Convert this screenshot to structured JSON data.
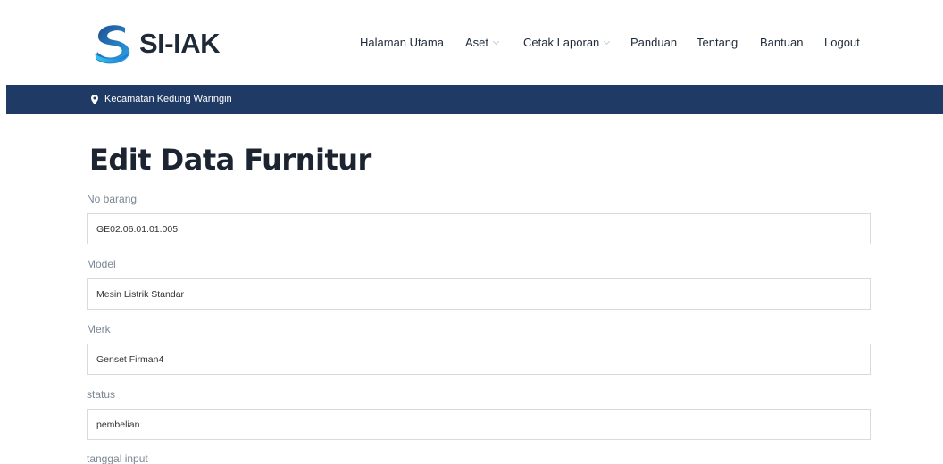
{
  "brand": {
    "name": "SI-IAK",
    "icon": "s-wave-logo"
  },
  "nav": {
    "items": [
      {
        "label": "Halaman Utama",
        "dropdown": false
      },
      {
        "label": "Aset",
        "dropdown": true
      },
      {
        "label": "Cetak Laporan",
        "dropdown": true
      },
      {
        "label": "Panduan",
        "dropdown": false
      },
      {
        "label": "Tentang",
        "dropdown": false
      },
      {
        "label": "Bantuan",
        "dropdown": false
      },
      {
        "label": "Logout",
        "dropdown": false
      }
    ]
  },
  "topbar": {
    "location": "Kecamatan Kedung Waringin",
    "icon": "map-pin-icon",
    "color": "#1f3a64"
  },
  "page": {
    "title": "Edit Data Furnitur"
  },
  "form": {
    "fields": [
      {
        "label": "No barang",
        "value": "GE02.06.01.01.005"
      },
      {
        "label": "Model",
        "value": "Mesin Listrik Standar"
      },
      {
        "label": "Merk",
        "value": "Genset Firman4"
      },
      {
        "label": "status",
        "value": "pembelian"
      },
      {
        "label": "tanggal input",
        "value": ""
      }
    ]
  }
}
